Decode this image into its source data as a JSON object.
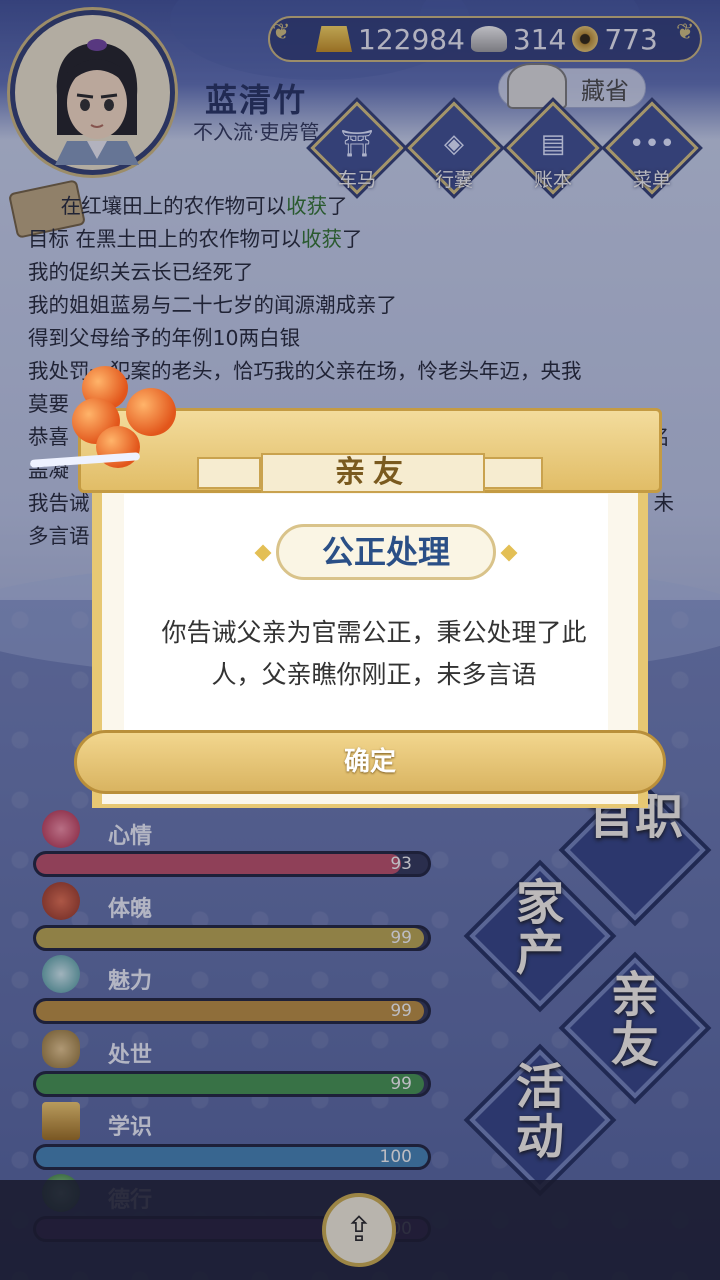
{
  "player": {
    "name": "蓝清竹",
    "rank": "不入流·吏房管"
  },
  "resources": {
    "gold": "122984",
    "silver": "314",
    "coin": "773"
  },
  "storage_label": "藏省",
  "top_menu": [
    {
      "label": "车马",
      "icon": "carriage-icon"
    },
    {
      "label": "行囊",
      "icon": "bag-icon"
    },
    {
      "label": "账本",
      "icon": "ledger-icon"
    },
    {
      "label": "菜单",
      "icon": "more-icon"
    }
  ],
  "log": {
    "l1a": "在红壤田上的农作物可以",
    "l1b": "收获",
    "l1c": "了",
    "l2a": "目标 在黑土田上的农作物可以",
    "l2b": "收获",
    "l2c": "了",
    "l3": "我的促织关云长已经死了",
    "l4": "我的姐姐蓝易与二十七岁的闻源潮成亲了",
    "l5": "得到父母给予的年例10两白银",
    "l6": "我处罚一犯案的老头，恰巧我的父亲在场，怜老头年迈，央我",
    "l7": "莫要",
    "l8a": "恭喜",
    "l8b": "名",
    "l9": "盖凝",
    "l10a": "我告诫",
    "l10b": "，未",
    "l11": "多言语"
  },
  "stats": [
    {
      "label": "心情",
      "value": "93",
      "pct": 0.93,
      "color": "#b84a63",
      "icon": "flower-icon"
    },
    {
      "label": "体魄",
      "value": "99",
      "pct": 0.99,
      "color": "#b8a24a",
      "icon": "drum-icon"
    },
    {
      "label": "魅力",
      "value": "99",
      "pct": 0.99,
      "color": "#b88a3a",
      "icon": "mirror-icon"
    },
    {
      "label": "处世",
      "value": "99",
      "pct": 0.99,
      "color": "#3f8f4a",
      "icon": "shoes-icon"
    },
    {
      "label": "学识",
      "value": "100",
      "pct": 1.0,
      "color": "#3f7fb0",
      "icon": "books-icon"
    },
    {
      "label": "德行",
      "value": "100",
      "pct": 1.0,
      "color": "#6a3f90",
      "icon": "jade-icon"
    }
  ],
  "nav": {
    "official": "官职",
    "property": "家产",
    "relatives": "亲友",
    "activity": "活动"
  },
  "modal": {
    "header": "亲友",
    "title": "公正处理",
    "message": "你告诫父亲为官需公正，秉公处理了此人，父亲瞧你刚正，未多言语",
    "confirm": "确定"
  }
}
